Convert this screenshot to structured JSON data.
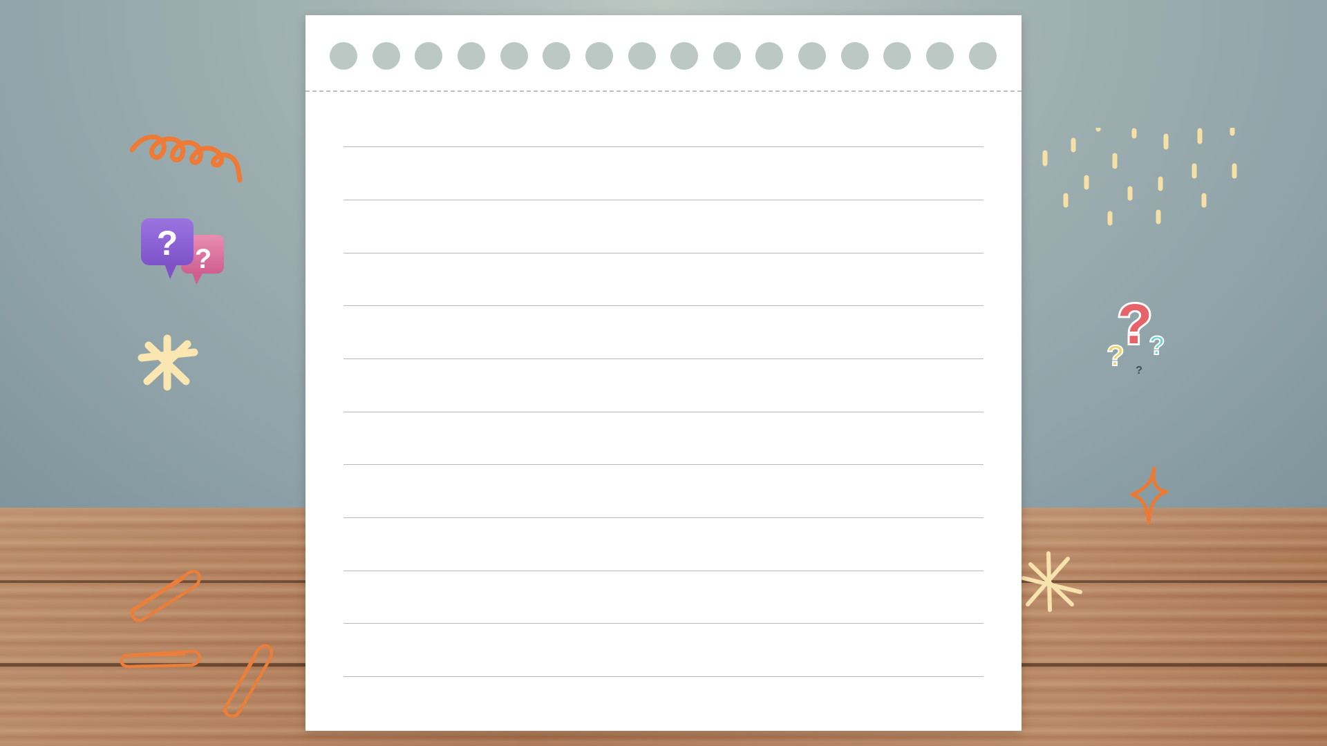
{
  "scene": {
    "description_free": true,
    "notebook": {
      "binding_hole_count": 16,
      "ruled_line_count": 11
    },
    "colors": {
      "wall": "#9fb0b0",
      "table_wood": "#a9764f",
      "paper": "#ffffff",
      "binding_hole": "#bcc8c4",
      "rule_line": "#b5b9bc",
      "orange_doodle": "#ee7a35",
      "cream_doodle": "#f7e3ad",
      "purple_bubble": "#8e64d6",
      "pink_bubble": "#d9699a",
      "red_question": "#e7636a",
      "teal_question": "#6fd2d4"
    },
    "decorations": {
      "left": [
        "squiggle-doodle-icon",
        "question-speech-bubbles-icon",
        "asterisk-star-icon",
        "paperclip-icon",
        "paperclip-icon",
        "paperclip-icon"
      ],
      "right": [
        "dash-rain-doodle-icon",
        "question-marks-icon",
        "sparkle-diamond-icon",
        "asterisk-star-icon"
      ]
    },
    "bubbles": {
      "big_mark": "?",
      "small_mark": "?"
    },
    "question_marks": {
      "big": "?",
      "left": "?",
      "right": "?",
      "small": "?"
    }
  }
}
